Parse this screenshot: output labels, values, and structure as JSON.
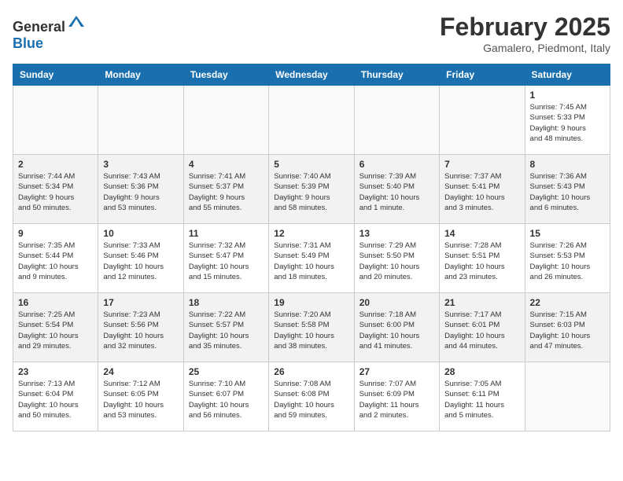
{
  "header": {
    "logo_general": "General",
    "logo_blue": "Blue",
    "month_title": "February 2025",
    "location": "Gamalero, Piedmont, Italy"
  },
  "weekdays": [
    "Sunday",
    "Monday",
    "Tuesday",
    "Wednesday",
    "Thursday",
    "Friday",
    "Saturday"
  ],
  "weeks": [
    [
      {
        "day": "",
        "info": ""
      },
      {
        "day": "",
        "info": ""
      },
      {
        "day": "",
        "info": ""
      },
      {
        "day": "",
        "info": ""
      },
      {
        "day": "",
        "info": ""
      },
      {
        "day": "",
        "info": ""
      },
      {
        "day": "1",
        "info": "Sunrise: 7:45 AM\nSunset: 5:33 PM\nDaylight: 9 hours\nand 48 minutes."
      }
    ],
    [
      {
        "day": "2",
        "info": "Sunrise: 7:44 AM\nSunset: 5:34 PM\nDaylight: 9 hours\nand 50 minutes."
      },
      {
        "day": "3",
        "info": "Sunrise: 7:43 AM\nSunset: 5:36 PM\nDaylight: 9 hours\nand 53 minutes."
      },
      {
        "day": "4",
        "info": "Sunrise: 7:41 AM\nSunset: 5:37 PM\nDaylight: 9 hours\nand 55 minutes."
      },
      {
        "day": "5",
        "info": "Sunrise: 7:40 AM\nSunset: 5:39 PM\nDaylight: 9 hours\nand 58 minutes."
      },
      {
        "day": "6",
        "info": "Sunrise: 7:39 AM\nSunset: 5:40 PM\nDaylight: 10 hours\nand 1 minute."
      },
      {
        "day": "7",
        "info": "Sunrise: 7:37 AM\nSunset: 5:41 PM\nDaylight: 10 hours\nand 3 minutes."
      },
      {
        "day": "8",
        "info": "Sunrise: 7:36 AM\nSunset: 5:43 PM\nDaylight: 10 hours\nand 6 minutes."
      }
    ],
    [
      {
        "day": "9",
        "info": "Sunrise: 7:35 AM\nSunset: 5:44 PM\nDaylight: 10 hours\nand 9 minutes."
      },
      {
        "day": "10",
        "info": "Sunrise: 7:33 AM\nSunset: 5:46 PM\nDaylight: 10 hours\nand 12 minutes."
      },
      {
        "day": "11",
        "info": "Sunrise: 7:32 AM\nSunset: 5:47 PM\nDaylight: 10 hours\nand 15 minutes."
      },
      {
        "day": "12",
        "info": "Sunrise: 7:31 AM\nSunset: 5:49 PM\nDaylight: 10 hours\nand 18 minutes."
      },
      {
        "day": "13",
        "info": "Sunrise: 7:29 AM\nSunset: 5:50 PM\nDaylight: 10 hours\nand 20 minutes."
      },
      {
        "day": "14",
        "info": "Sunrise: 7:28 AM\nSunset: 5:51 PM\nDaylight: 10 hours\nand 23 minutes."
      },
      {
        "day": "15",
        "info": "Sunrise: 7:26 AM\nSunset: 5:53 PM\nDaylight: 10 hours\nand 26 minutes."
      }
    ],
    [
      {
        "day": "16",
        "info": "Sunrise: 7:25 AM\nSunset: 5:54 PM\nDaylight: 10 hours\nand 29 minutes."
      },
      {
        "day": "17",
        "info": "Sunrise: 7:23 AM\nSunset: 5:56 PM\nDaylight: 10 hours\nand 32 minutes."
      },
      {
        "day": "18",
        "info": "Sunrise: 7:22 AM\nSunset: 5:57 PM\nDaylight: 10 hours\nand 35 minutes."
      },
      {
        "day": "19",
        "info": "Sunrise: 7:20 AM\nSunset: 5:58 PM\nDaylight: 10 hours\nand 38 minutes."
      },
      {
        "day": "20",
        "info": "Sunrise: 7:18 AM\nSunset: 6:00 PM\nDaylight: 10 hours\nand 41 minutes."
      },
      {
        "day": "21",
        "info": "Sunrise: 7:17 AM\nSunset: 6:01 PM\nDaylight: 10 hours\nand 44 minutes."
      },
      {
        "day": "22",
        "info": "Sunrise: 7:15 AM\nSunset: 6:03 PM\nDaylight: 10 hours\nand 47 minutes."
      }
    ],
    [
      {
        "day": "23",
        "info": "Sunrise: 7:13 AM\nSunset: 6:04 PM\nDaylight: 10 hours\nand 50 minutes."
      },
      {
        "day": "24",
        "info": "Sunrise: 7:12 AM\nSunset: 6:05 PM\nDaylight: 10 hours\nand 53 minutes."
      },
      {
        "day": "25",
        "info": "Sunrise: 7:10 AM\nSunset: 6:07 PM\nDaylight: 10 hours\nand 56 minutes."
      },
      {
        "day": "26",
        "info": "Sunrise: 7:08 AM\nSunset: 6:08 PM\nDaylight: 10 hours\nand 59 minutes."
      },
      {
        "day": "27",
        "info": "Sunrise: 7:07 AM\nSunset: 6:09 PM\nDaylight: 11 hours\nand 2 minutes."
      },
      {
        "day": "28",
        "info": "Sunrise: 7:05 AM\nSunset: 6:11 PM\nDaylight: 11 hours\nand 5 minutes."
      },
      {
        "day": "",
        "info": ""
      }
    ]
  ]
}
